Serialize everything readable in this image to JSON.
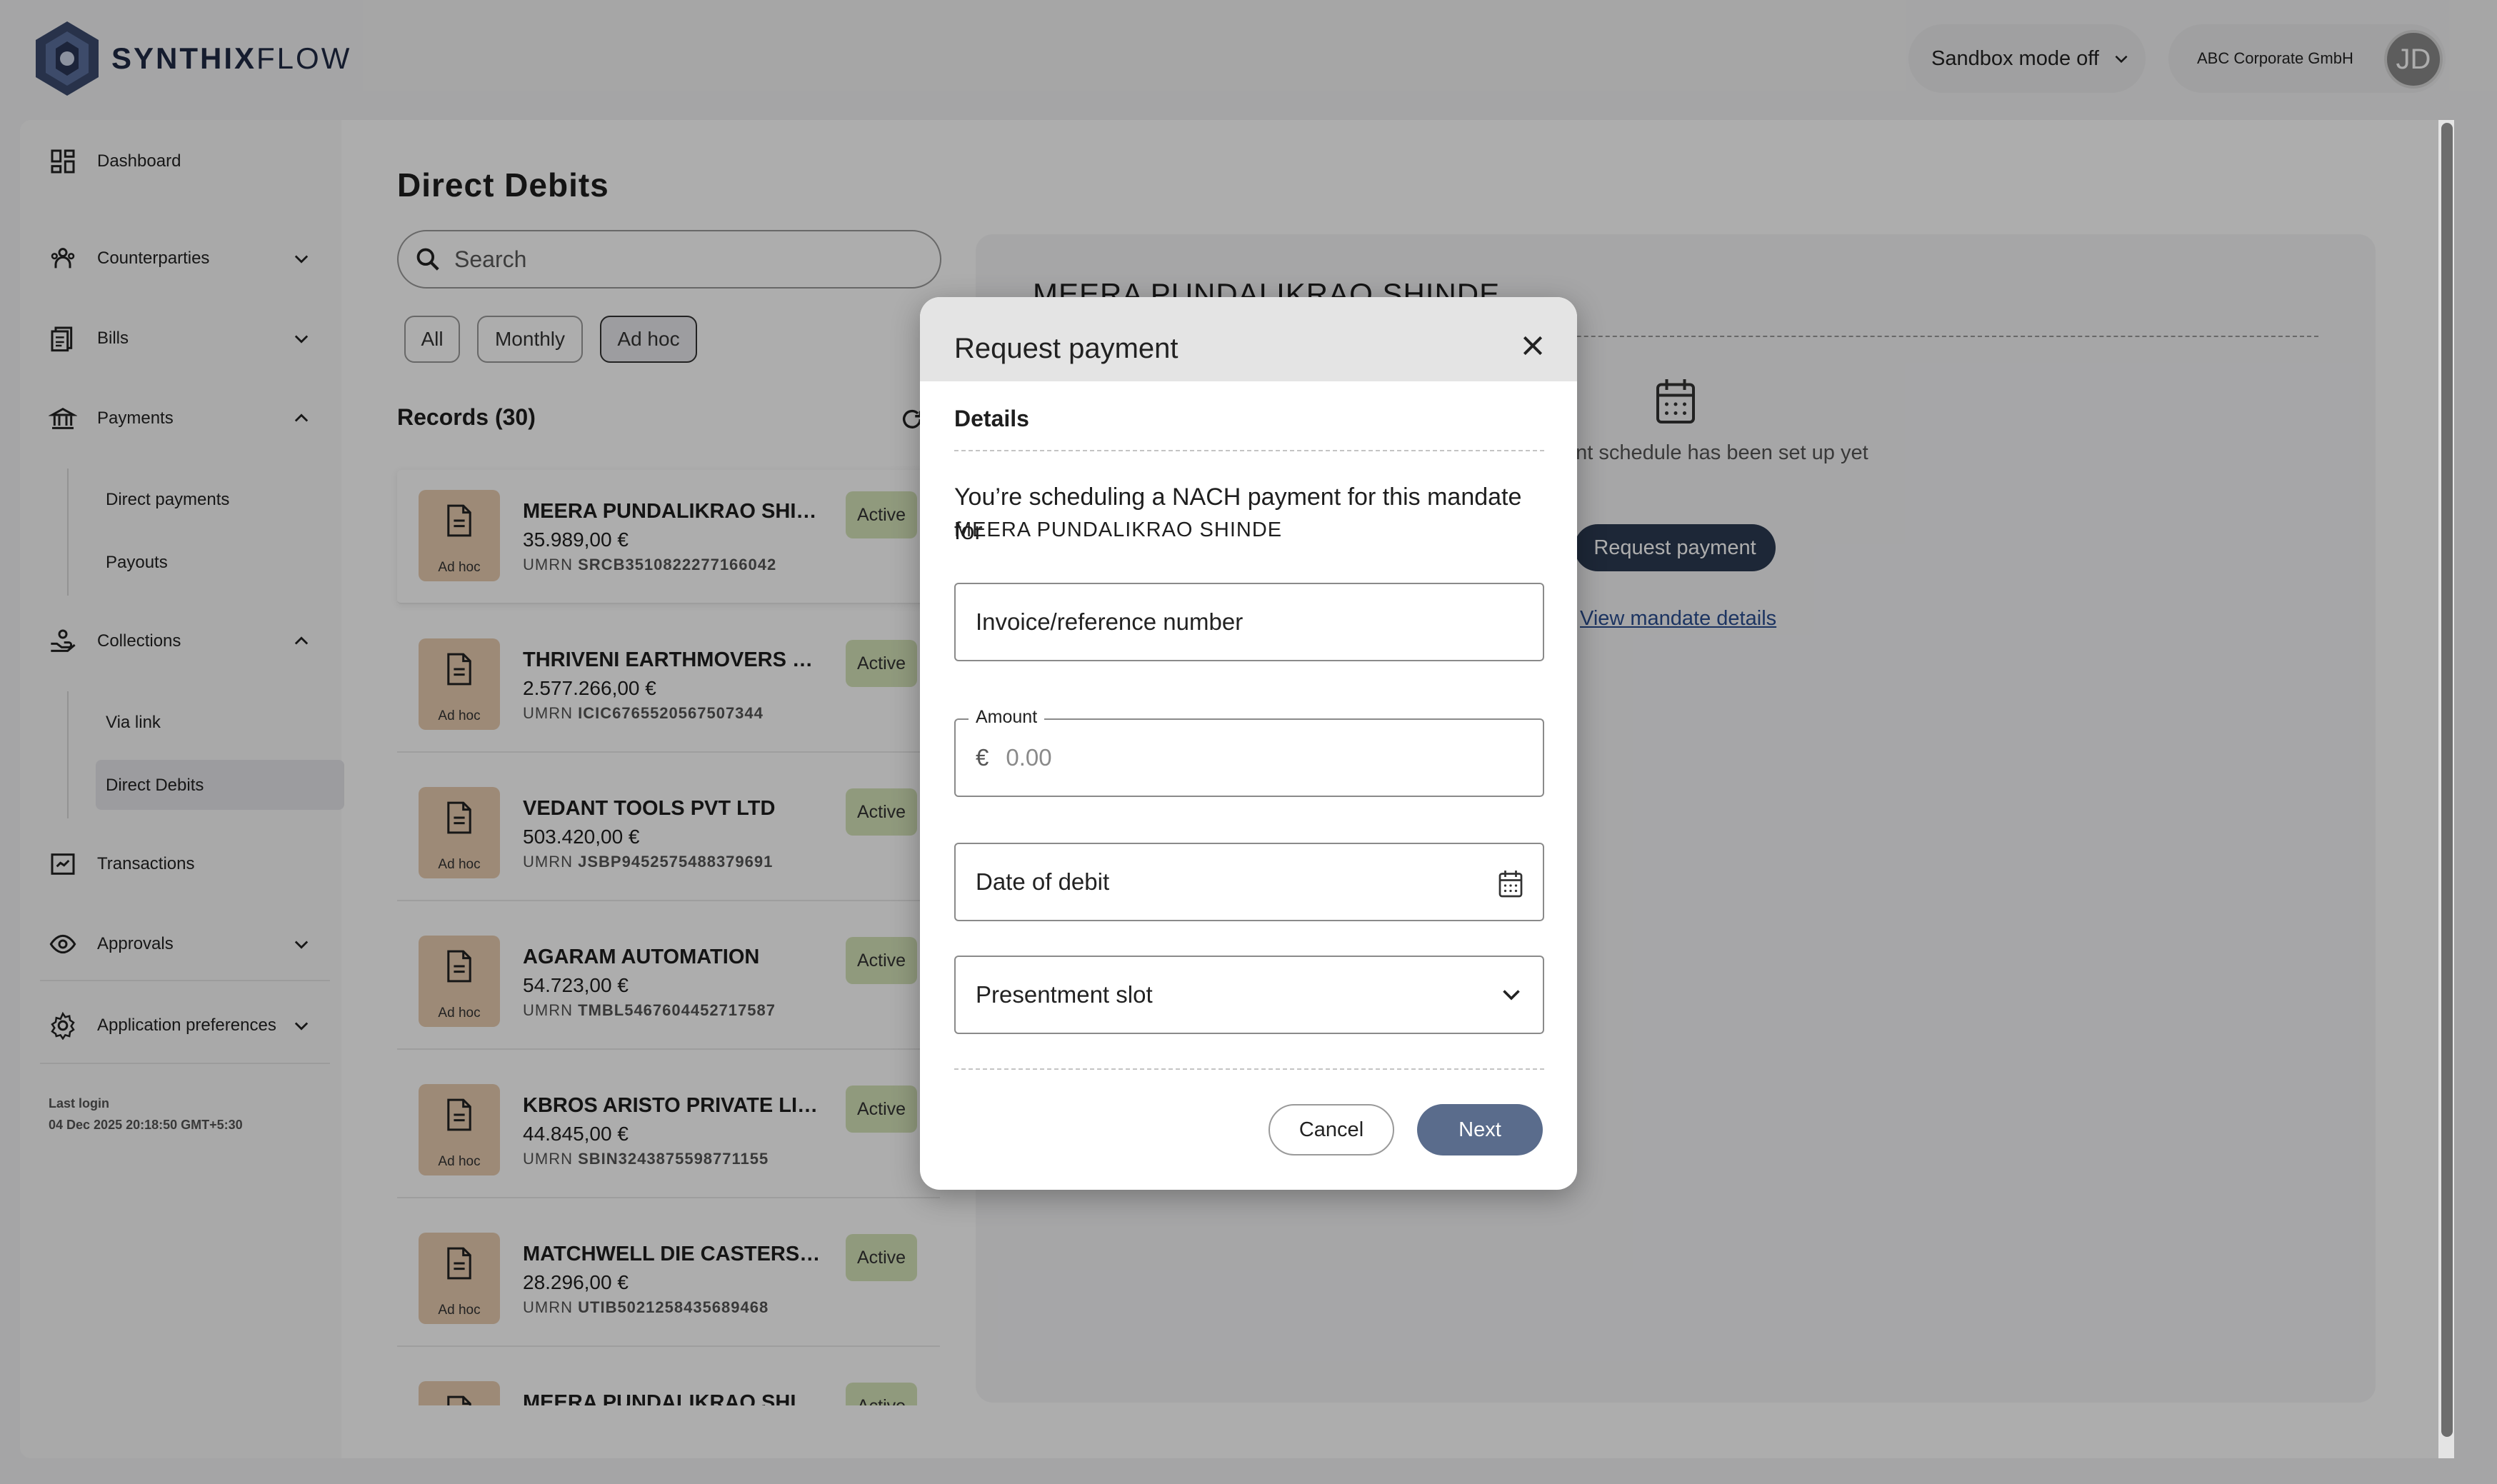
{
  "header": {
    "brand_bold": "SYNTHIX",
    "brand_light": "FLOW",
    "sandbox_label": "Sandbox mode off",
    "account_name": "ABC Corporate GmbH",
    "avatar_initials": "JD"
  },
  "sidebar": {
    "dashboard": "Dashboard",
    "counterparties": "Counterparties",
    "bills": "Bills",
    "payments": "Payments",
    "direct_payments": "Direct payments",
    "payouts": "Payouts",
    "collections": "Collections",
    "via_link": "Via link",
    "direct_debits": "Direct Debits",
    "transactions": "Transactions",
    "approvals": "Approvals",
    "app_prefs": "Application preferences",
    "last_login_label": "Last login",
    "last_login_value": "04 Dec 2025 20:18:50 GMT+5:30"
  },
  "main": {
    "title": "Direct Debits",
    "search_placeholder": "Search",
    "filters": [
      "All",
      "Monthly",
      "Ad hoc"
    ],
    "selected_filter": "Ad hoc",
    "records_label": "Records (30)",
    "records": [
      {
        "name": "MEERA PUNDALIKRAO SHINDE",
        "amount": "35.989,00 €",
        "umrn_label": "UMRN",
        "umrn": "SRCB3510822277166042",
        "type": "Ad hoc",
        "status": "Active"
      },
      {
        "name": "THRIVENI EARTHMOVERS PRIVATE LIMITED",
        "amount": "2.577.266,00 €",
        "umrn_label": "UMRN",
        "umrn": "ICIC6765520567507344",
        "type": "Ad hoc",
        "status": "Active"
      },
      {
        "name": "VEDANT TOOLS PVT LTD",
        "amount": "503.420,00 €",
        "umrn_label": "UMRN",
        "umrn": "JSBP9452575488379691",
        "type": "Ad hoc",
        "status": "Active"
      },
      {
        "name": "AGARAM AUTOMATION",
        "amount": "54.723,00 €",
        "umrn_label": "UMRN",
        "umrn": "TMBL5467604452717587",
        "type": "Ad hoc",
        "status": "Active"
      },
      {
        "name": "KBROS ARISTO PRIVATE LIMITED",
        "amount": "44.845,00 €",
        "umrn_label": "UMRN",
        "umrn": "SBIN3243875598771155",
        "type": "Ad hoc",
        "status": "Active"
      },
      {
        "name": "MATCHWELL DIE CASTERS PRIVATE LIMITED",
        "amount": "28.296,00 €",
        "umrn_label": "UMRN",
        "umrn": "UTIB5021258435689468",
        "type": "Ad hoc",
        "status": "Active"
      },
      {
        "name": "MEERA PUNDALIKRAO SHINDE",
        "amount": "",
        "umrn_label": "",
        "umrn": "",
        "type": "Ad hoc",
        "status": "Active"
      }
    ]
  },
  "detail": {
    "title": "MEERA PUNDALIKRAO SHINDE",
    "empty_text": "ent schedule has been set up yet",
    "request_button": "Request payment",
    "view_link": "View mandate details"
  },
  "modal": {
    "title": "Request payment",
    "section_title": "Details",
    "description": "You’re scheduling a NACH payment for this mandate for",
    "mandate_name": "MEERA PUNDALIKRAO SHINDE",
    "invoice_placeholder": "Invoice/reference number",
    "amount_label": "Amount",
    "currency_symbol": "€",
    "amount_placeholder": "0.00",
    "date_placeholder": "Date of debit",
    "slot_placeholder": "Presentment slot",
    "cancel_label": "Cancel",
    "next_label": "Next"
  }
}
